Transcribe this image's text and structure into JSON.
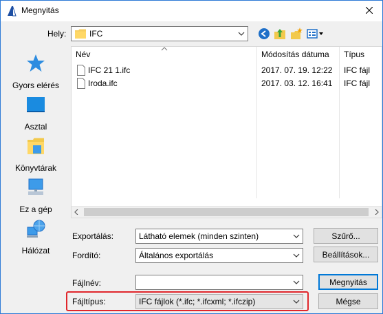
{
  "window": {
    "title": "Megnyitás",
    "app_icon": "archicad-icon",
    "close_icon": "close-icon"
  },
  "location": {
    "label": "Hely:",
    "value": "IFC",
    "toolbar_icons": [
      "back-icon",
      "up-folder-icon",
      "new-folder-icon",
      "view-menu-icon"
    ]
  },
  "sidebar": {
    "items": [
      {
        "label": "Gyors elérés",
        "icon": "star-icon"
      },
      {
        "label": "Asztal",
        "icon": "desktop-icon"
      },
      {
        "label": "Könyvtárak",
        "icon": "libraries-icon"
      },
      {
        "label": "Ez a gép",
        "icon": "computer-icon"
      },
      {
        "label": "Hálózat",
        "icon": "network-icon"
      }
    ]
  },
  "filelist": {
    "columns": {
      "name": "Név",
      "date": "Módosítás dátuma",
      "type": "Típus"
    },
    "files": [
      {
        "name": "IFC 21 1.ifc",
        "date": "2017. 07. 19. 12:22",
        "type": "IFC fájl"
      },
      {
        "name": "Iroda.ifc",
        "date": "2017. 03. 12. 16:41",
        "type": "IFC fájl"
      }
    ]
  },
  "form": {
    "export_label": "Exportálás:",
    "export_value": "Látható elemek (minden szinten)",
    "filter_button": "Szűrő...",
    "translator_label": "Fordító:",
    "translator_value": "Általános exportálás",
    "settings_button": "Beállítások...",
    "filename_label": "Fájlnév:",
    "filename_value": "",
    "open_button": "Megnyitás",
    "filetype_label": "Fájltípus:",
    "filetype_value": "IFC fájlok (*.ifc; *.ifcxml; *.ifczip)",
    "cancel_button": "Mégse"
  },
  "colors": {
    "highlight_box": "#e0262b",
    "accent": "#0078d7"
  }
}
